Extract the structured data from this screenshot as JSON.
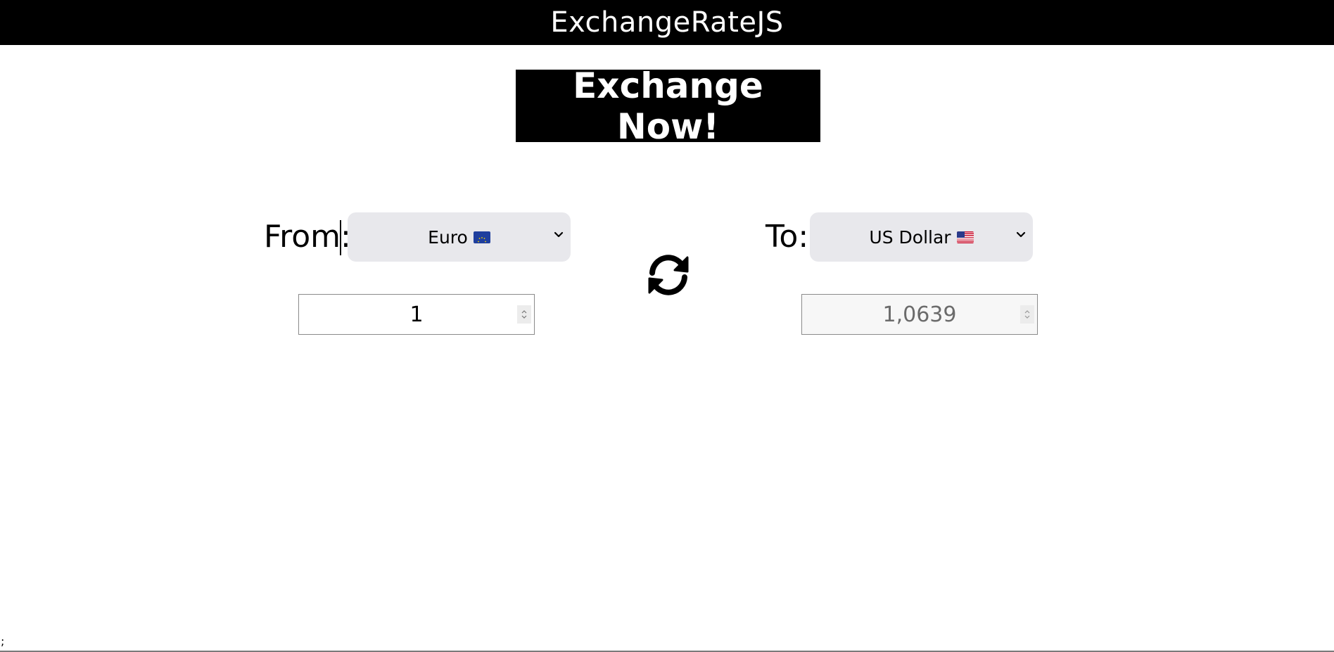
{
  "header": {
    "title": "ExchangeRateJS"
  },
  "main": {
    "exchange_button": "Exchange Now!",
    "from": {
      "label": "From:",
      "currency": "Euro",
      "flag": "eu-flag-icon",
      "amount": "1"
    },
    "to": {
      "label": "To:",
      "currency": "US Dollar",
      "flag": "us-flag-icon",
      "amount": "1,0639"
    },
    "swap_icon": "swap-icon"
  },
  "footer": {
    "mark": ";"
  },
  "colors": {
    "header_bg": "#000000",
    "button_bg": "#000000",
    "select_bg": "#e8e8ec",
    "page_bg": "#ffffff"
  }
}
